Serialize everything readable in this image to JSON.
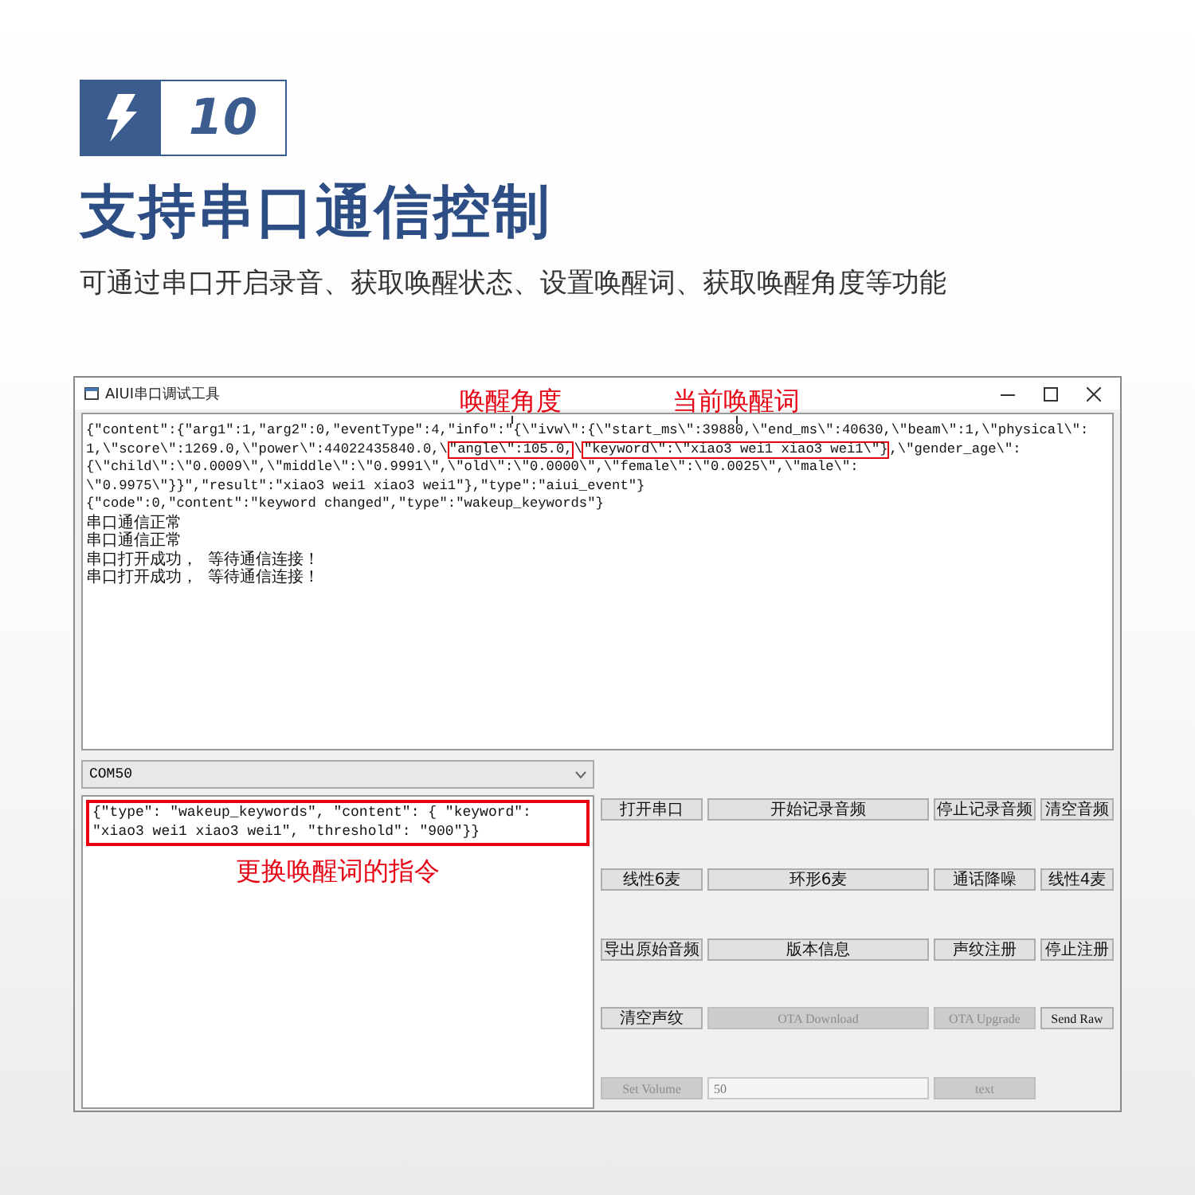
{
  "header": {
    "number": "10",
    "title": "支持串口通信控制",
    "subtitle": "可通过串口开启录音、获取唤醒状态、设置唤醒词、获取唤醒角度等功能"
  },
  "window": {
    "title": "AIUI串口调试工具",
    "log_lines": [
      [
        {
          "text": "{\"content\":{\"arg1\":1,\"arg2\":0,\"eventType\":4,\"info\":\"{\\\"ivw\\\":{\\\"start_ms\\\":39880,\\\"end_ms\\\":40630,\\\"beam\\\":1,\\\"physical\\\":",
          "boxed": false
        }
      ],
      [
        {
          "text": "1,\\\"score\\\":1269.0,\\\"power\\\":44022435840.0,\\",
          "boxed": false
        },
        {
          "text": "\"angle\\\":105.0,",
          "boxed": true,
          "callout": "唤醒角度"
        },
        {
          "text": "\\",
          "boxed": false
        },
        {
          "text": "\"keyword\\\":\\\"xiao3 wei1 xiao3 wei1\\\"}",
          "boxed": true,
          "callout": "当前唤醒词"
        },
        {
          "text": ",\\\"gender_age\\\":",
          "boxed": false
        }
      ],
      [
        {
          "text": "{\\\"child\\\":\\\"0.0009\\\",\\\"middle\\\":\\\"0.9991\\\",\\\"old\\\":\\\"0.0000\\\",\\\"female\\\":\\\"0.0025\\\",\\\"male\\\":",
          "boxed": false
        }
      ],
      [
        {
          "text": "\\\"0.9975\\\"}}\",\"result\":\"xiao3 wei1 xiao3 wei1\"},\"type\":\"aiui_event\"}",
          "boxed": false
        }
      ],
      [
        {
          "text": "{\"code\":0,\"content\":\"keyword changed\",\"type\":\"wakeup_keywords\"}",
          "boxed": false
        }
      ],
      [
        {
          "text": "串口通信正常",
          "boxed": false
        }
      ],
      [
        {
          "text": "串口通信正常",
          "boxed": false
        }
      ],
      [
        {
          "text": "串口打开成功，  等待通信连接！",
          "boxed": false
        }
      ],
      [
        {
          "text": "串口打开成功，  等待通信连接！",
          "boxed": false
        }
      ]
    ],
    "port": "COM50",
    "command": {
      "text": "{\"type\": \"wakeup_keywords\", \"content\": { \"keyword\": \"xiao3 wei1 xiao3 wei1\", \"threshold\": \"900\"}}",
      "callout": "更换唤醒词的指令"
    },
    "button_rows": [
      [
        {
          "kind": "button",
          "label": "打开串口",
          "disabled": false
        },
        {
          "kind": "button",
          "label": "开始记录音频",
          "disabled": false
        },
        {
          "kind": "button",
          "label": "停止记录音频",
          "disabled": false
        },
        {
          "kind": "button",
          "label": "清空音频",
          "disabled": false
        }
      ],
      [
        {
          "kind": "button",
          "label": "线性6麦",
          "disabled": false
        },
        {
          "kind": "button",
          "label": "环形6麦",
          "disabled": false
        },
        {
          "kind": "button",
          "label": "通话降噪",
          "disabled": false
        },
        {
          "kind": "button",
          "label": "线性4麦",
          "disabled": false
        }
      ],
      [
        {
          "kind": "button",
          "label": "导出原始音频",
          "disabled": false
        },
        {
          "kind": "button",
          "label": "版本信息",
          "disabled": false
        },
        {
          "kind": "button",
          "label": "声纹注册",
          "disabled": false
        },
        {
          "kind": "button",
          "label": "停止注册",
          "disabled": false
        }
      ],
      [
        {
          "kind": "button",
          "label": "清空声纹",
          "disabled": false
        },
        {
          "kind": "button",
          "label": "OTA Download",
          "disabled": true
        },
        {
          "kind": "button",
          "label": "OTA Upgrade",
          "disabled": true
        },
        {
          "kind": "button",
          "label": "Send Raw",
          "disabled": false
        }
      ],
      [
        {
          "kind": "button",
          "label": "Set Volume",
          "disabled": true
        },
        {
          "kind": "field",
          "value": "50",
          "disabled": false
        },
        {
          "kind": "button",
          "label": "text",
          "disabled": true
        }
      ]
    ]
  }
}
